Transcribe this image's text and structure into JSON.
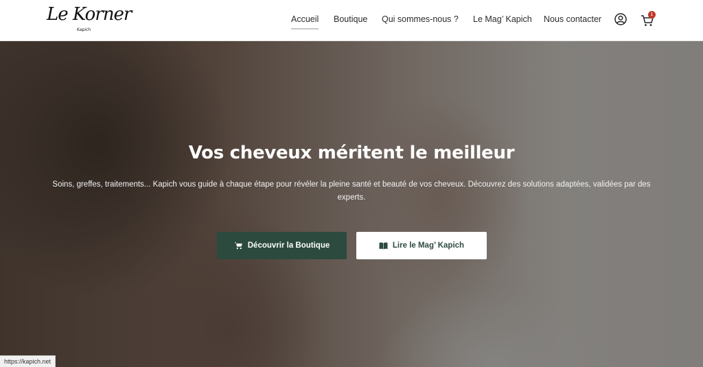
{
  "brand": {
    "logo_text": "Le Korner",
    "logo_subtext": "Kapich"
  },
  "nav": {
    "items": [
      {
        "label": "Accueil",
        "active": true
      },
      {
        "label": "Boutique",
        "active": false
      },
      {
        "label": "Qui sommes-nous ?",
        "active": false
      },
      {
        "label": "Le Mag’ Kapich",
        "active": false
      },
      {
        "label": "Nous contacter",
        "active": false
      }
    ],
    "account_icon": "user-circle-icon",
    "cart_icon": "cart-icon",
    "cart_count": "1"
  },
  "hero": {
    "title": "Vos cheveux méritent le meilleur",
    "text": "Soins, greffes, traitements... Kapich vous guide à chaque étape pour révéler la pleine santé et beauté de vos cheveux. Découvrez des solutions adaptées, validées par des experts.",
    "primary_button": {
      "label": "Découvrir la Boutique",
      "icon": "cart-icon"
    },
    "secondary_button": {
      "label": "Lire le Mag’ Kapich",
      "icon": "book-icon"
    }
  },
  "status_bar": {
    "url": "https://kapich.net"
  },
  "colors": {
    "accent": "#2c4a3e",
    "badge": "#c0392b",
    "background": "#ffffff"
  }
}
